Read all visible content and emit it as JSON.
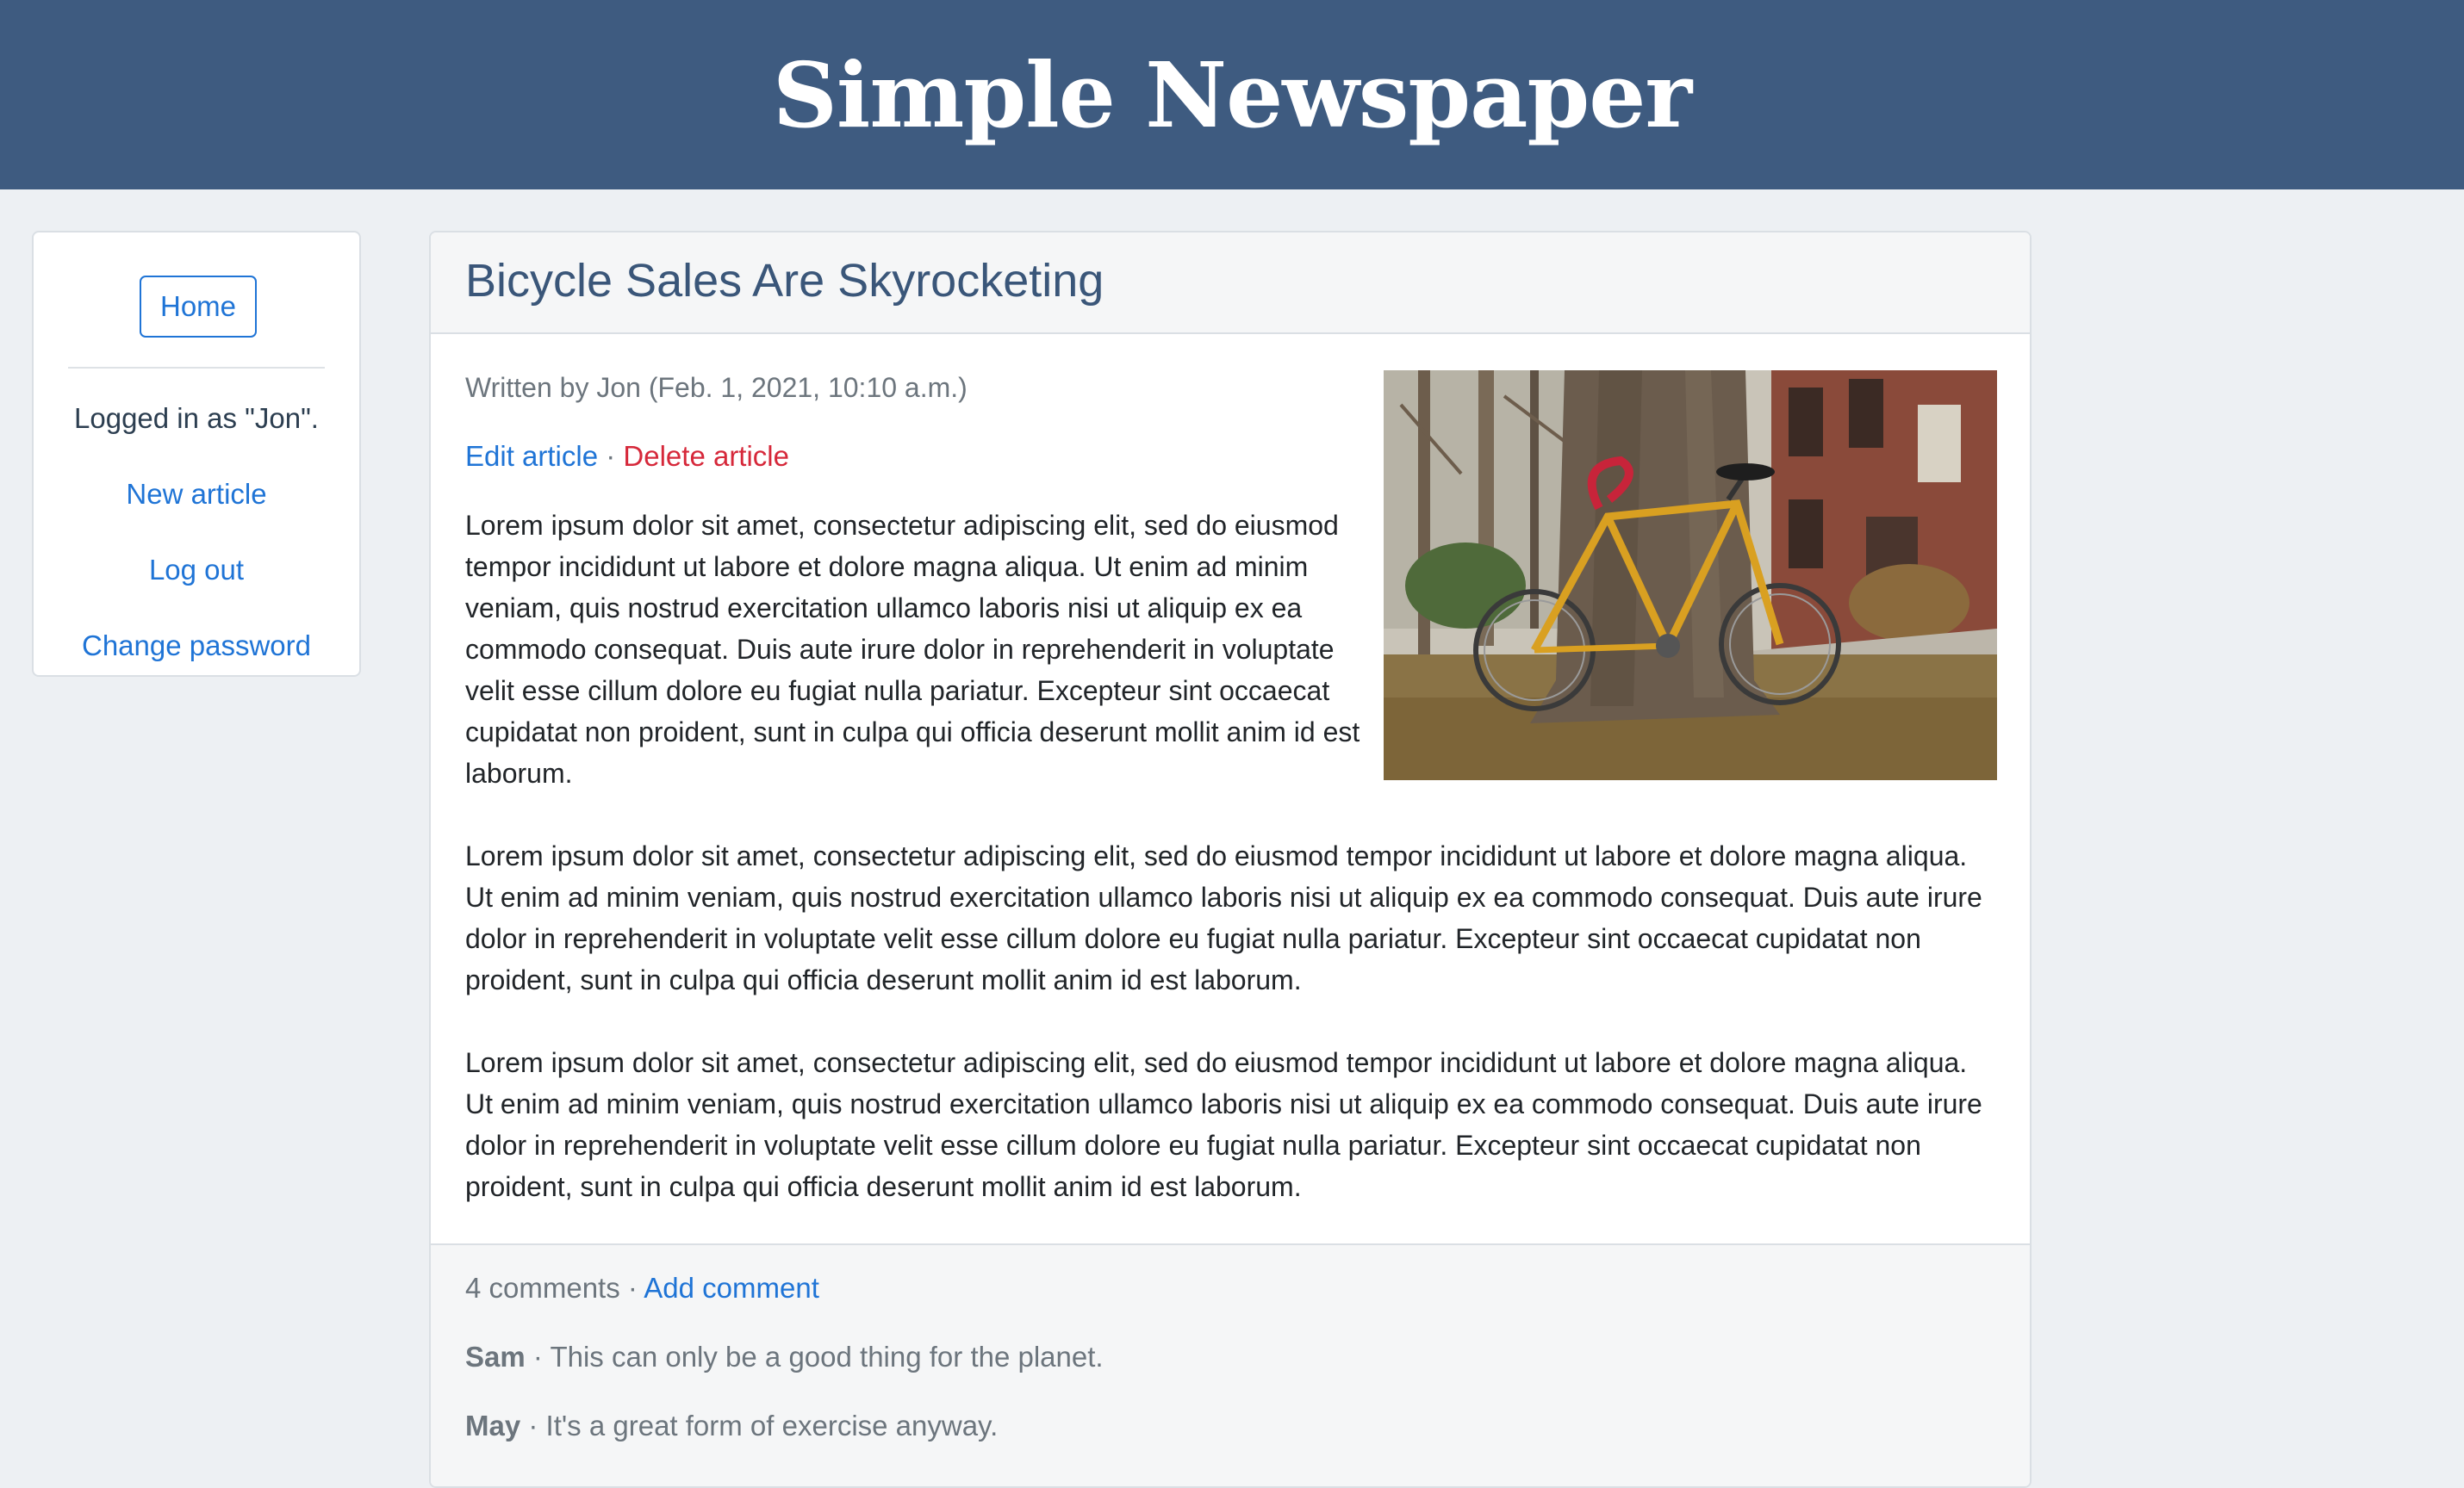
{
  "site": {
    "title": "Simple Newspaper"
  },
  "sidebar": {
    "home_label": "Home",
    "logged_in_text": "Logged in as \"Jon\".",
    "links": [
      "New article",
      "Log out",
      "Change password"
    ]
  },
  "article": {
    "title": "Bicycle Sales Are Skyrocketing",
    "byline": "Written by Jon (Feb. 1, 2021, 10:10 a.m.)",
    "edit_label": "Edit article",
    "separator": "·",
    "delete_label": "Delete article",
    "image_subject": "yellow road bicycle leaning against a tree trunk",
    "paragraphs": [
      "Lorem ipsum dolor sit amet, consectetur adipiscing elit, sed do eiusmod tempor incididunt ut labore et dolore magna aliqua. Ut enim ad minim veniam, quis nostrud exercitation ullamco laboris nisi ut aliquip ex ea commodo consequat. Duis aute irure dolor in reprehenderit in voluptate velit esse cillum dolore eu fugiat nulla pariatur. Excepteur sint occaecat cupidatat non proident, sunt in culpa qui officia deserunt mollit anim id est laborum.",
      "Lorem ipsum dolor sit amet, consectetur adipiscing elit, sed do eiusmod tempor incididunt ut labore et dolore magna aliqua. Ut enim ad minim veniam, quis nostrud exercitation ullamco laboris nisi ut aliquip ex ea commodo consequat. Duis aute irure dolor in reprehenderit in voluptate velit esse cillum dolore eu fugiat nulla pariatur. Excepteur sint occaecat cupidatat non proident, sunt in culpa qui officia deserunt mollit anim id est laborum.",
      "Lorem ipsum dolor sit amet, consectetur adipiscing elit, sed do eiusmod tempor incididunt ut labore et dolore magna aliqua. Ut enim ad minim veniam, quis nostrud exercitation ullamco laboris nisi ut aliquip ex ea commodo consequat. Duis aute irure dolor in reprehenderit in voluptate velit esse cillum dolore eu fugiat nulla pariatur. Excepteur sint occaecat cupidatat non proident, sunt in culpa qui officia deserunt mollit anim id est laborum."
    ]
  },
  "comments": {
    "count_label": "4 comments",
    "separator": "·",
    "add_label": "Add comment",
    "items": [
      {
        "author": "Sam",
        "separator": "·",
        "text": "This can only be a good thing for the planet."
      },
      {
        "author": "May",
        "separator": "·",
        "text": "It's a great form of exercise anyway."
      }
    ]
  },
  "colors": {
    "header_bg": "#3e5b80",
    "page_bg": "#edf0f3",
    "link": "#1f74d6",
    "danger": "#d6283a",
    "muted": "#6c757d"
  }
}
